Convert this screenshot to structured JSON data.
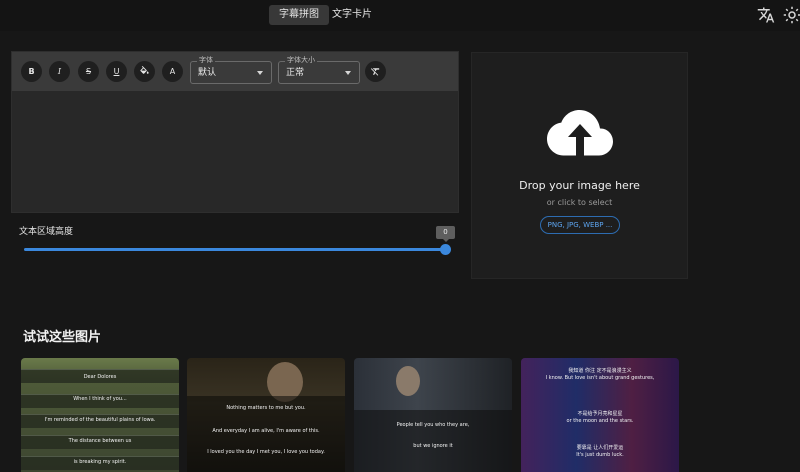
{
  "nav": {
    "tabs": [
      {
        "label": "字幕拼图",
        "active": true
      },
      {
        "label": "文字卡片",
        "active": false
      }
    ],
    "icons": [
      "translate-icon",
      "theme-icon"
    ]
  },
  "editor": {
    "buttons": {
      "bold": "B",
      "italic": "I",
      "strike": "S",
      "underline": "U",
      "color": "A"
    },
    "font": {
      "label": "字体",
      "value": "默认"
    },
    "size": {
      "label": "字体大小",
      "value": "正常"
    }
  },
  "slider": {
    "label": "文本区域高度",
    "value": "0",
    "fill_fraction": 1.0
  },
  "upload": {
    "title": "Drop your image here",
    "subtitle": "or click to select",
    "formats": "PNG, JPG, WEBP ..."
  },
  "samples": {
    "title": "试试这些图片",
    "items": [
      {
        "lines": [
          "Dear Dolores",
          "When I think of you...",
          "I'm reminded of the beautiful plains of Iowa.",
          "The distance between us",
          "is breaking my spirit."
        ]
      },
      {
        "lines": [
          "Nothing matters to me but you.",
          "And everyday I am alive, I'm aware of this.",
          "I loved you the day I met you, I love you today."
        ]
      },
      {
        "lines": [
          "People tell you who they are,",
          "but we ignore it"
        ]
      },
      {
        "lines": [
          "我知道 你注 定不是浪漫主义",
          "I know. But love isn't about grand gestures,",
          "不是给予月亮和星星",
          "or the moon and the stars.",
          "要靠是 让人们开爱运",
          "It's just dumb luck."
        ]
      }
    ]
  },
  "colors": {
    "accent": "#3b88dd",
    "background": "#171717",
    "panel": "#282828",
    "toolbar": "#3a3a3a"
  }
}
